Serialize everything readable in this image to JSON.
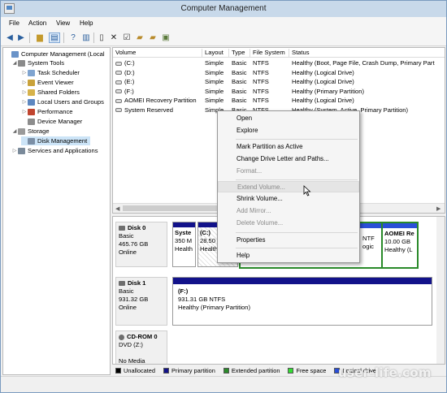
{
  "window": {
    "title": "Computer Management"
  },
  "menu": [
    "File",
    "Action",
    "View",
    "Help"
  ],
  "tree": [
    {
      "label": "Computer Management (Local",
      "twisty": ""
    },
    {
      "label": "System Tools",
      "twisty": "◢"
    },
    {
      "label": "Task Scheduler",
      "twisty": "▷"
    },
    {
      "label": "Event Viewer",
      "twisty": "▷"
    },
    {
      "label": "Shared Folders",
      "twisty": "▷"
    },
    {
      "label": "Local Users and Groups",
      "twisty": "▷"
    },
    {
      "label": "Performance",
      "twisty": "▷"
    },
    {
      "label": "Device Manager",
      "twisty": ""
    },
    {
      "label": "Storage",
      "twisty": "◢"
    },
    {
      "label": "Disk Management",
      "twisty": ""
    },
    {
      "label": "Services and Applications",
      "twisty": "▷"
    }
  ],
  "volumes": {
    "headers": [
      "Volume",
      "Layout",
      "Type",
      "File System",
      "Status"
    ],
    "rows": [
      [
        "(C:)",
        "Simple",
        "Basic",
        "NTFS",
        "Healthy (Boot, Page File, Crash Dump, Primary Part"
      ],
      [
        "(D:)",
        "Simple",
        "Basic",
        "NTFS",
        "Healthy (Logical Drive)"
      ],
      [
        "(E:)",
        "Simple",
        "Basic",
        "NTFS",
        "Healthy (Logical Drive)"
      ],
      [
        "(F:)",
        "Simple",
        "Basic",
        "NTFS",
        "Healthy (Primary Partition)"
      ],
      [
        "AOMEI Recovery Partition",
        "Simple",
        "Basic",
        "NTFS",
        "Healthy (Logical Drive)"
      ],
      [
        "System Reserved",
        "Simple",
        "Basic",
        "NTFS",
        "Healthy (System, Active, Primary Partition)"
      ]
    ]
  },
  "disks": [
    {
      "name": "Disk 0",
      "type": "Basic",
      "size": "465.76 GB",
      "state": "Online"
    },
    {
      "name": "Disk 1",
      "type": "Basic",
      "size": "931.32 GB",
      "state": "Online"
    },
    {
      "name": "CD-ROM 0",
      "type": "DVD (Z:)",
      "size": "",
      "state": "No Media"
    }
  ],
  "disk0_parts": [
    {
      "l1": "Syste",
      "l2": "350 M",
      "l3": "Health"
    },
    {
      "l1": "(C:)",
      "l2": "28.50 G",
      "l3": "Health"
    },
    {
      "l1": "",
      "l2": "NTF",
      "l3": "ogic"
    },
    {
      "l1": "AOMEI Re",
      "l2": "10.00 GB",
      "l3": "Healthy (L"
    }
  ],
  "disk1_part": {
    "l1": "(F:)",
    "l2": "931.31 GB NTFS",
    "l3": "Healthy (Primary Partition)"
  },
  "legend": [
    {
      "label": "Unallocated",
      "color": "#000000"
    },
    {
      "label": "Primary partition",
      "color": "#12128a"
    },
    {
      "label": "Extended partition",
      "color": "#2a8a2a"
    },
    {
      "label": "Free space",
      "color": "#33dd33"
    },
    {
      "label": "Logical drive",
      "color": "#2a4fd8"
    }
  ],
  "context_menu": [
    {
      "label": "Open",
      "enabled": true
    },
    {
      "label": "Explore",
      "enabled": true
    },
    {
      "label": "Mark Partition as Active",
      "enabled": true
    },
    {
      "label": "Change Drive Letter and Paths...",
      "enabled": true
    },
    {
      "label": "Format...",
      "enabled": false
    },
    {
      "label": "Extend Volume...",
      "enabled": false
    },
    {
      "label": "Shrink Volume...",
      "enabled": true
    },
    {
      "label": "Add Mirror...",
      "enabled": false
    },
    {
      "label": "Delete Volume...",
      "enabled": false
    },
    {
      "label": "Properties",
      "enabled": true
    },
    {
      "label": "Help",
      "enabled": true
    }
  ],
  "watermark": "user-life.com"
}
